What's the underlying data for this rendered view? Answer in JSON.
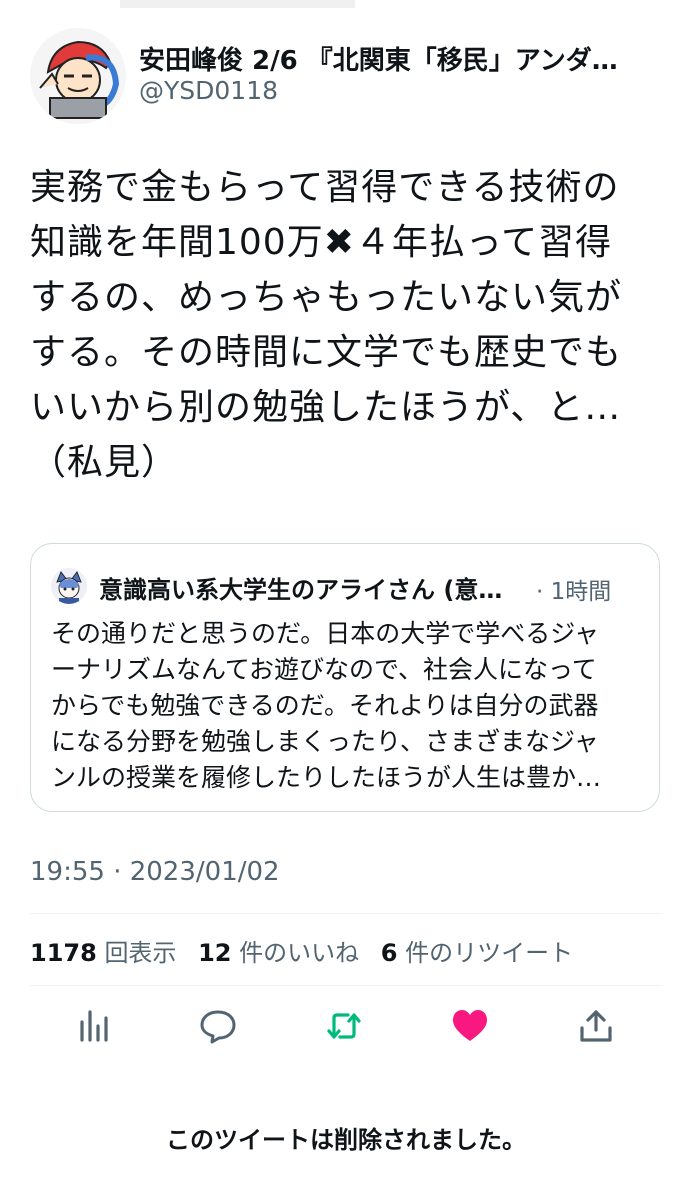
{
  "author": {
    "display_name": "安田峰俊 2/6 『北関東「移民」アンダ…",
    "handle": "@YSD0118"
  },
  "tweet": {
    "lines": [
      "実務で金もらって習得できる技術の",
      "知識を年間100万✖４年払って習得",
      "するの、めっちゃもったいない気が",
      "する。その時間に文学でも歴史でも",
      "いいから別の勉強したほうが、と…",
      "（私見）"
    ]
  },
  "quote": {
    "name": "意識高い系大学生のアライさん (意…",
    "time": "· 1時間",
    "lines": [
      "その通りだと思うのだ。日本の大学で学べるジャ",
      "ーナリズムなんてお遊びなので、社会人になって",
      "からでも勉強できるのだ。それよりは自分の武器",
      "になる分野を勉強しまくったり、さまざまなジャ",
      "ンルの授業を履修したりしたほうが人生は豊か…"
    ]
  },
  "timestamp": "19:55 · 2023/01/02",
  "stats": {
    "views_num": "1178",
    "views_label": "回表示",
    "likes_num": "12",
    "likes_label": "件のいいね",
    "retweets_num": "6",
    "retweets_label": "件のリツイート"
  },
  "actions": {
    "icons": [
      "analytics-icon",
      "reply-icon",
      "retweet-icon",
      "like-icon",
      "share-icon"
    ],
    "retweet_color": "#00ba7c",
    "like_color": "#f91880",
    "default_color": "#536471"
  },
  "footer": {
    "deleted_notice": "このツイートは削除されました。"
  }
}
